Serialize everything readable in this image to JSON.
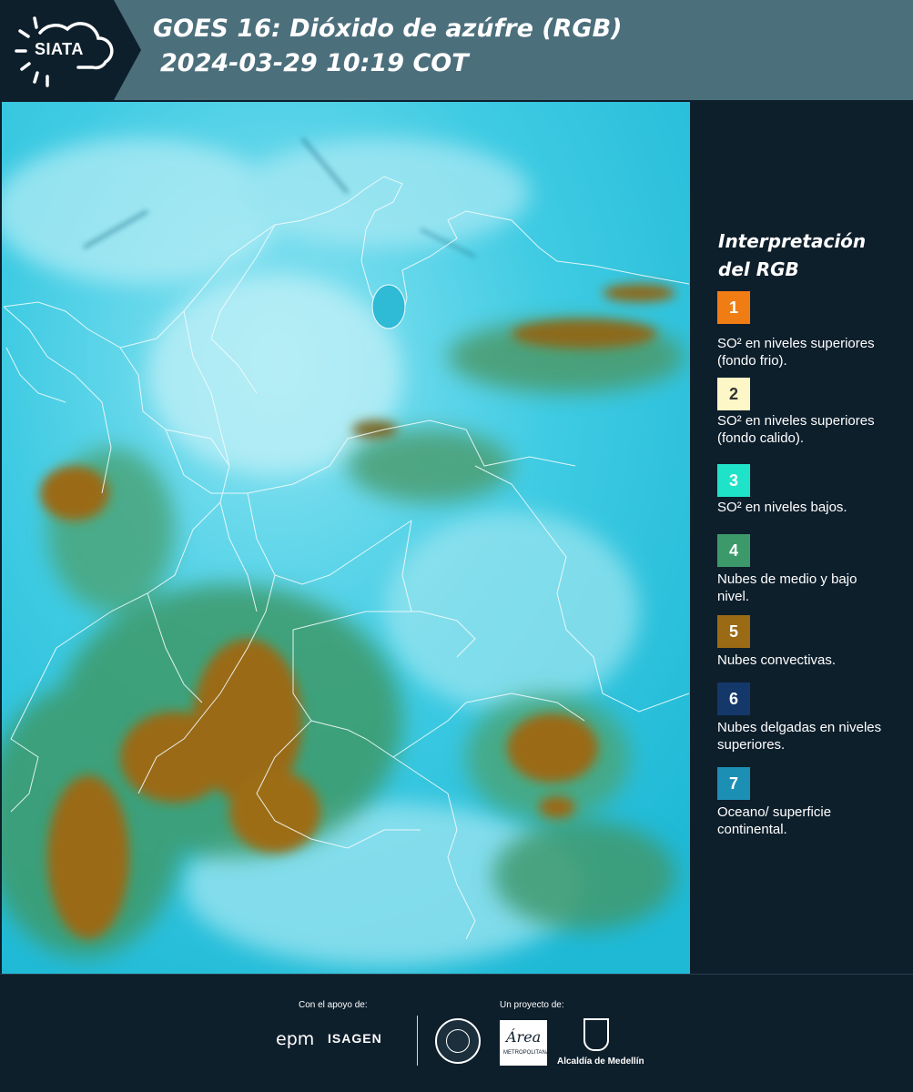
{
  "header": {
    "logo_text": "SIATA",
    "title_line1": "GOES 16: Dióxido de azúfre (RGB)",
    "title_line2": "2024-03-29 10:19 COT"
  },
  "legend": {
    "title_line1": "Interpretación",
    "title_line2": "del RGB",
    "items": [
      {
        "number": "1",
        "color": "#f07d14",
        "text_color": "#ffffff",
        "label": "SO² en niveles superiores (fondo frio)."
      },
      {
        "number": "2",
        "color": "#fdf6c6",
        "text_color": "#333333",
        "label": "SO² en niveles superiores (fondo calido)."
      },
      {
        "number": "3",
        "color": "#1ee3c8",
        "text_color": "#ffffff",
        "label": "SO² en niveles bajos."
      },
      {
        "number": "4",
        "color": "#3c9a6a",
        "text_color": "#ffffff",
        "label": "Nubes de medio y bajo nivel."
      },
      {
        "number": "5",
        "color": "#9a6a14",
        "text_color": "#ffffff",
        "label": "Nubes convectivas."
      },
      {
        "number": "6",
        "color": "#14386a",
        "text_color": "#ffffff",
        "label": "Nubes delgadas en niveles superiores."
      },
      {
        "number": "7",
        "color": "#1c8fb4",
        "text_color": "#ffffff",
        "label": "Oceano/ superficie continental."
      }
    ]
  },
  "footer": {
    "support_label": "Con el apoyo de:",
    "project_label": "Un proyecto de:",
    "epm": "epm",
    "isagen": "ISAGEN",
    "area_text": "Área",
    "area_sub": "METROPOLITANA",
    "alcaldia": "Alcaldía de Medellín"
  },
  "colors": {
    "background": "#0e1f2c",
    "header": "#4c6f7c",
    "ocean": "#2bc3e0",
    "convective": "#9a6a14",
    "mid_low": "#3c9a6a"
  }
}
